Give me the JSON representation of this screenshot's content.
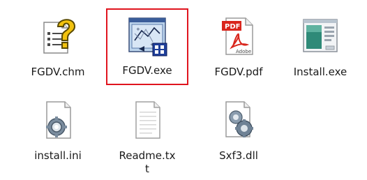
{
  "files": [
    {
      "name": "FGDV.chm",
      "icon": "help-file-icon"
    },
    {
      "name": "FGDV.exe",
      "icon": "application-icon",
      "selected": true
    },
    {
      "name": "FGDV.pdf",
      "icon": "pdf-icon"
    },
    {
      "name": "Install.exe",
      "icon": "installer-icon"
    },
    {
      "name": "install.ini",
      "icon": "settings-file-icon"
    },
    {
      "name_line1": "Readme.tx",
      "name_line2": "t",
      "icon": "text-file-icon"
    },
    {
      "name": "Sxf3.dll",
      "icon": "dll-file-icon"
    }
  ],
  "colors": {
    "selection_border": "#e0141e",
    "pdf_red": "#d9251c",
    "help_yellow": "#f2c20e"
  }
}
